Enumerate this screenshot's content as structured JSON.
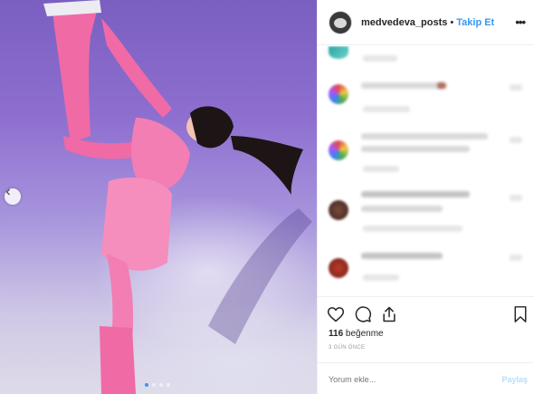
{
  "header": {
    "username": "medvedeva_posts",
    "separator": "•",
    "follow_label": "Takip Et",
    "more_icon": "•••"
  },
  "photo": {
    "carousel_dots": 4,
    "active_dot": 1
  },
  "engagement": {
    "likes_count": "116",
    "likes_label": "beğenme",
    "timestamp": "3 GÜN ÖNCE"
  },
  "comment": {
    "placeholder": "Yorum ekle...",
    "post_label": "Paylaş"
  },
  "icons": {
    "like": "heart-icon",
    "comment": "comment-icon",
    "share": "share-icon",
    "save": "bookmark-icon",
    "prev": "chevron-left-icon"
  },
  "colors": {
    "accent": "#3897f0",
    "post_disabled": "#b2dffc",
    "muted": "#999999"
  }
}
